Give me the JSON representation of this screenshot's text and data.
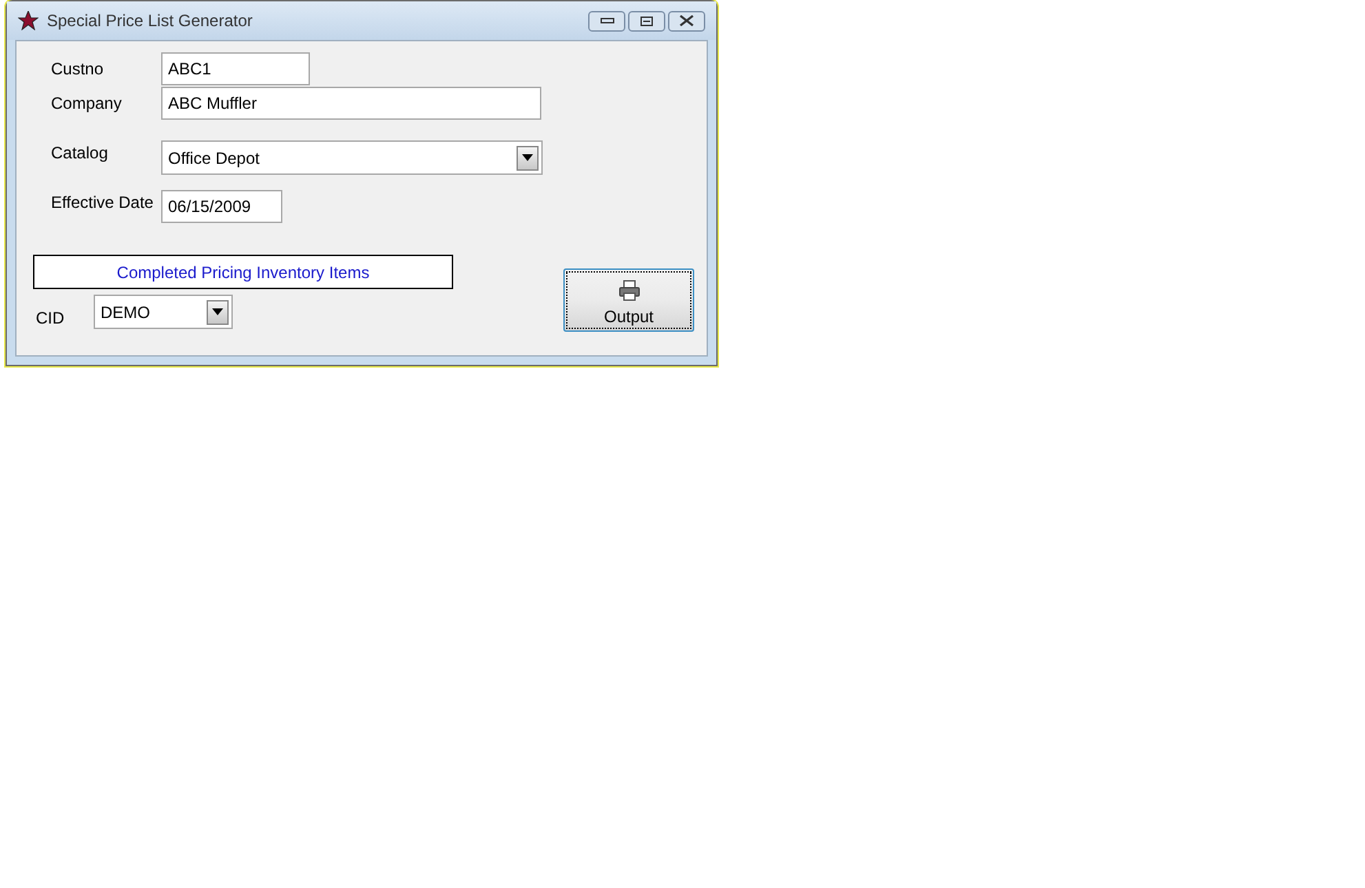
{
  "window": {
    "title": "Special Price List Generator"
  },
  "fields": [
    {
      "kind": "text",
      "label": "Custno",
      "value": "ABC1"
    },
    {
      "kind": "text",
      "label": "Company",
      "value": "ABC Muffler"
    },
    {
      "kind": "dropdown",
      "label": "Catalog",
      "value": "Office Depot"
    },
    {
      "kind": "text",
      "label": "Effective Date",
      "value": "06/15/2009"
    }
  ],
  "status": "Completed Pricing Inventory Items",
  "cid": {
    "label": "CID",
    "value": "DEMO"
  },
  "output_button": {
    "label": "Output"
  }
}
